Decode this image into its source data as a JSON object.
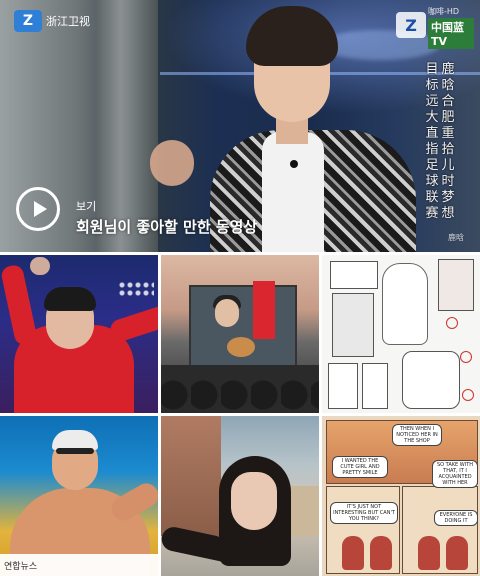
{
  "hero": {
    "channel_logo_text": "浙江卫视",
    "corner_hd_text": "咖啡-HD",
    "corner_tv_text": "中国蓝TV",
    "subtitle_col_1": "目标远大直指足球联赛",
    "subtitle_col_2": "鹿晗合肥重拾儿时梦想",
    "credit_text": "鹿晗",
    "label": "보기",
    "title": "회원님이 좋아할 만한 동영상"
  },
  "tiles": [
    {
      "name": "idol-red-hoodie-photo"
    },
    {
      "name": "guitarist-concert-photo"
    },
    {
      "name": "sketch-comic-page"
    },
    {
      "name": "swimmer-photo",
      "caption": "연합뉴스"
    },
    {
      "name": "selfie-photo"
    },
    {
      "name": "color-comic-page",
      "bubbles": [
        "THEN WHEN I NOTICED HER IN THE SHOP",
        "I WANTED THE CUTE GIRL AND PRETTY SMILE",
        "SO TAKE WITH THAT, IT I ACQUAINTED WITH HER",
        "IT'S JUST NOT INTERESTING BUT CAN'T YOU THINK?",
        "EVERYONE IS DOING IT"
      ]
    }
  ],
  "colors": {
    "accent_red": "#d8222b",
    "video_bg": "#1c2f52"
  }
}
